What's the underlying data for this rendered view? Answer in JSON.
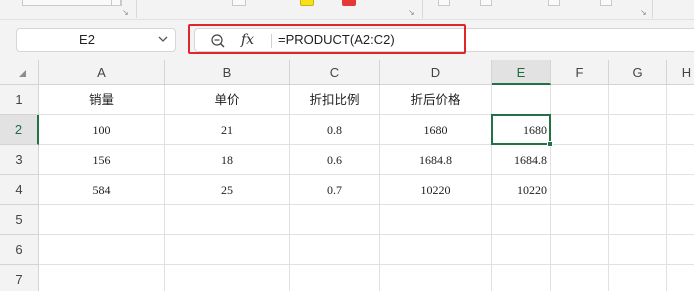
{
  "name_box": {
    "value": "E2"
  },
  "formula_bar": {
    "fx_label": "fx",
    "formula": "=PRODUCT(A2:C2)"
  },
  "columns": [
    "A",
    "B",
    "C",
    "D",
    "E",
    "F",
    "G",
    "H"
  ],
  "rows": [
    "1",
    "2",
    "3",
    "4",
    "5",
    "6",
    "7"
  ],
  "active_column": "E",
  "active_row": "2",
  "cells": [
    [
      "销量",
      "单价",
      "折扣比例",
      "折后价格",
      ""
    ],
    [
      "100",
      "21",
      "0.8",
      "1680",
      "1680"
    ],
    [
      "156",
      "18",
      "0.6",
      "1684.8",
      "1684.8"
    ],
    [
      "584",
      "25",
      "0.7",
      "10220",
      "10220"
    ]
  ],
  "colors": {
    "accent_green": "#217346",
    "highlight_red": "#e0262d"
  }
}
